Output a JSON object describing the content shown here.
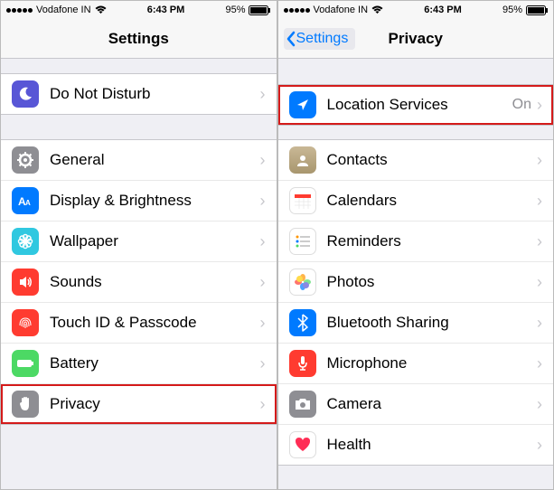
{
  "status": {
    "carrier": "Vodafone IN",
    "time": "6:43 PM",
    "battery": "95%"
  },
  "left": {
    "title": "Settings",
    "rows": {
      "dnd": "Do Not Disturb",
      "general": "General",
      "display": "Display & Brightness",
      "wallpaper": "Wallpaper",
      "sounds": "Sounds",
      "touchid": "Touch ID & Passcode",
      "battery": "Battery",
      "privacy": "Privacy"
    }
  },
  "right": {
    "back": "Settings",
    "title": "Privacy",
    "rows": {
      "location": "Location Services",
      "location_value": "On",
      "contacts": "Contacts",
      "calendars": "Calendars",
      "reminders": "Reminders",
      "photos": "Photos",
      "bluetooth": "Bluetooth Sharing",
      "microphone": "Microphone",
      "camera": "Camera",
      "health": "Health"
    }
  },
  "colors": {
    "dnd": "#5856d6",
    "general": "#8e8e93",
    "display": "#007aff",
    "wallpaper": "#30c8e0",
    "sounds": "#ff3b30",
    "touchid": "#ff3b30",
    "battery": "#4cd964",
    "privacy": "#8e8e93",
    "location": "#007aff",
    "contacts": "#a8966e",
    "calendars": "#ffffff",
    "reminders": "#ffffff",
    "photos": "#ffffff",
    "bluetooth": "#007aff",
    "microphone": "#ff3b30",
    "camera": "#8e8e93",
    "health": "#ffffff"
  }
}
